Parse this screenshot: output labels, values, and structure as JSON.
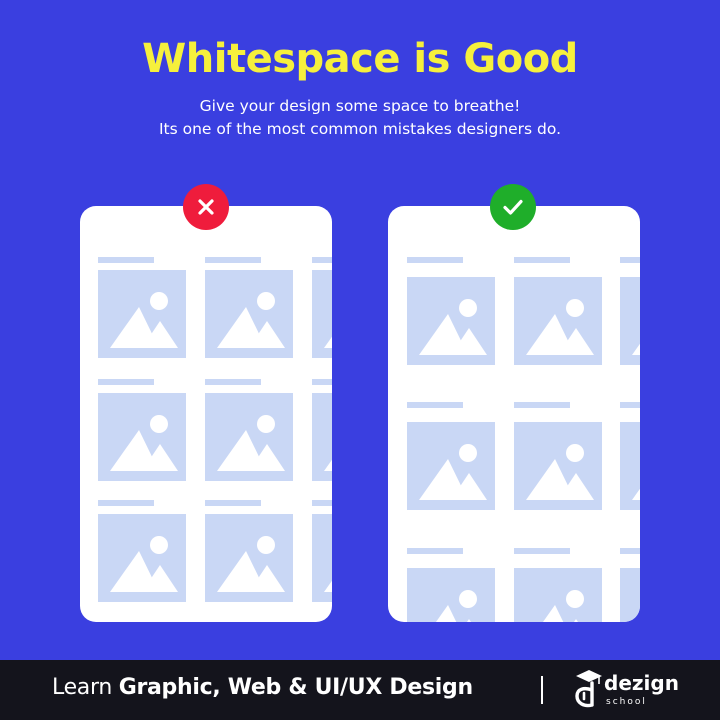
{
  "header": {
    "title": "Whitespace is Good",
    "subtitle_line1": "Give your design some space to breathe!",
    "subtitle_line2": "Its one of the most common mistakes designers do."
  },
  "comparison": {
    "bad_icon": "cross-icon",
    "good_icon": "check-icon",
    "bad_color": "#ef1c3c",
    "good_color": "#1fae2a",
    "placeholder_color": "#c9d7f5"
  },
  "footer": {
    "text_regular": "Learn ",
    "text_bold": "Graphic, Web & UI/UX Design",
    "logo_name": "dezign",
    "logo_sub": "school"
  },
  "colors": {
    "background": "#3a3fe0",
    "title": "#f6f03c",
    "footer_bg": "#14141c"
  }
}
